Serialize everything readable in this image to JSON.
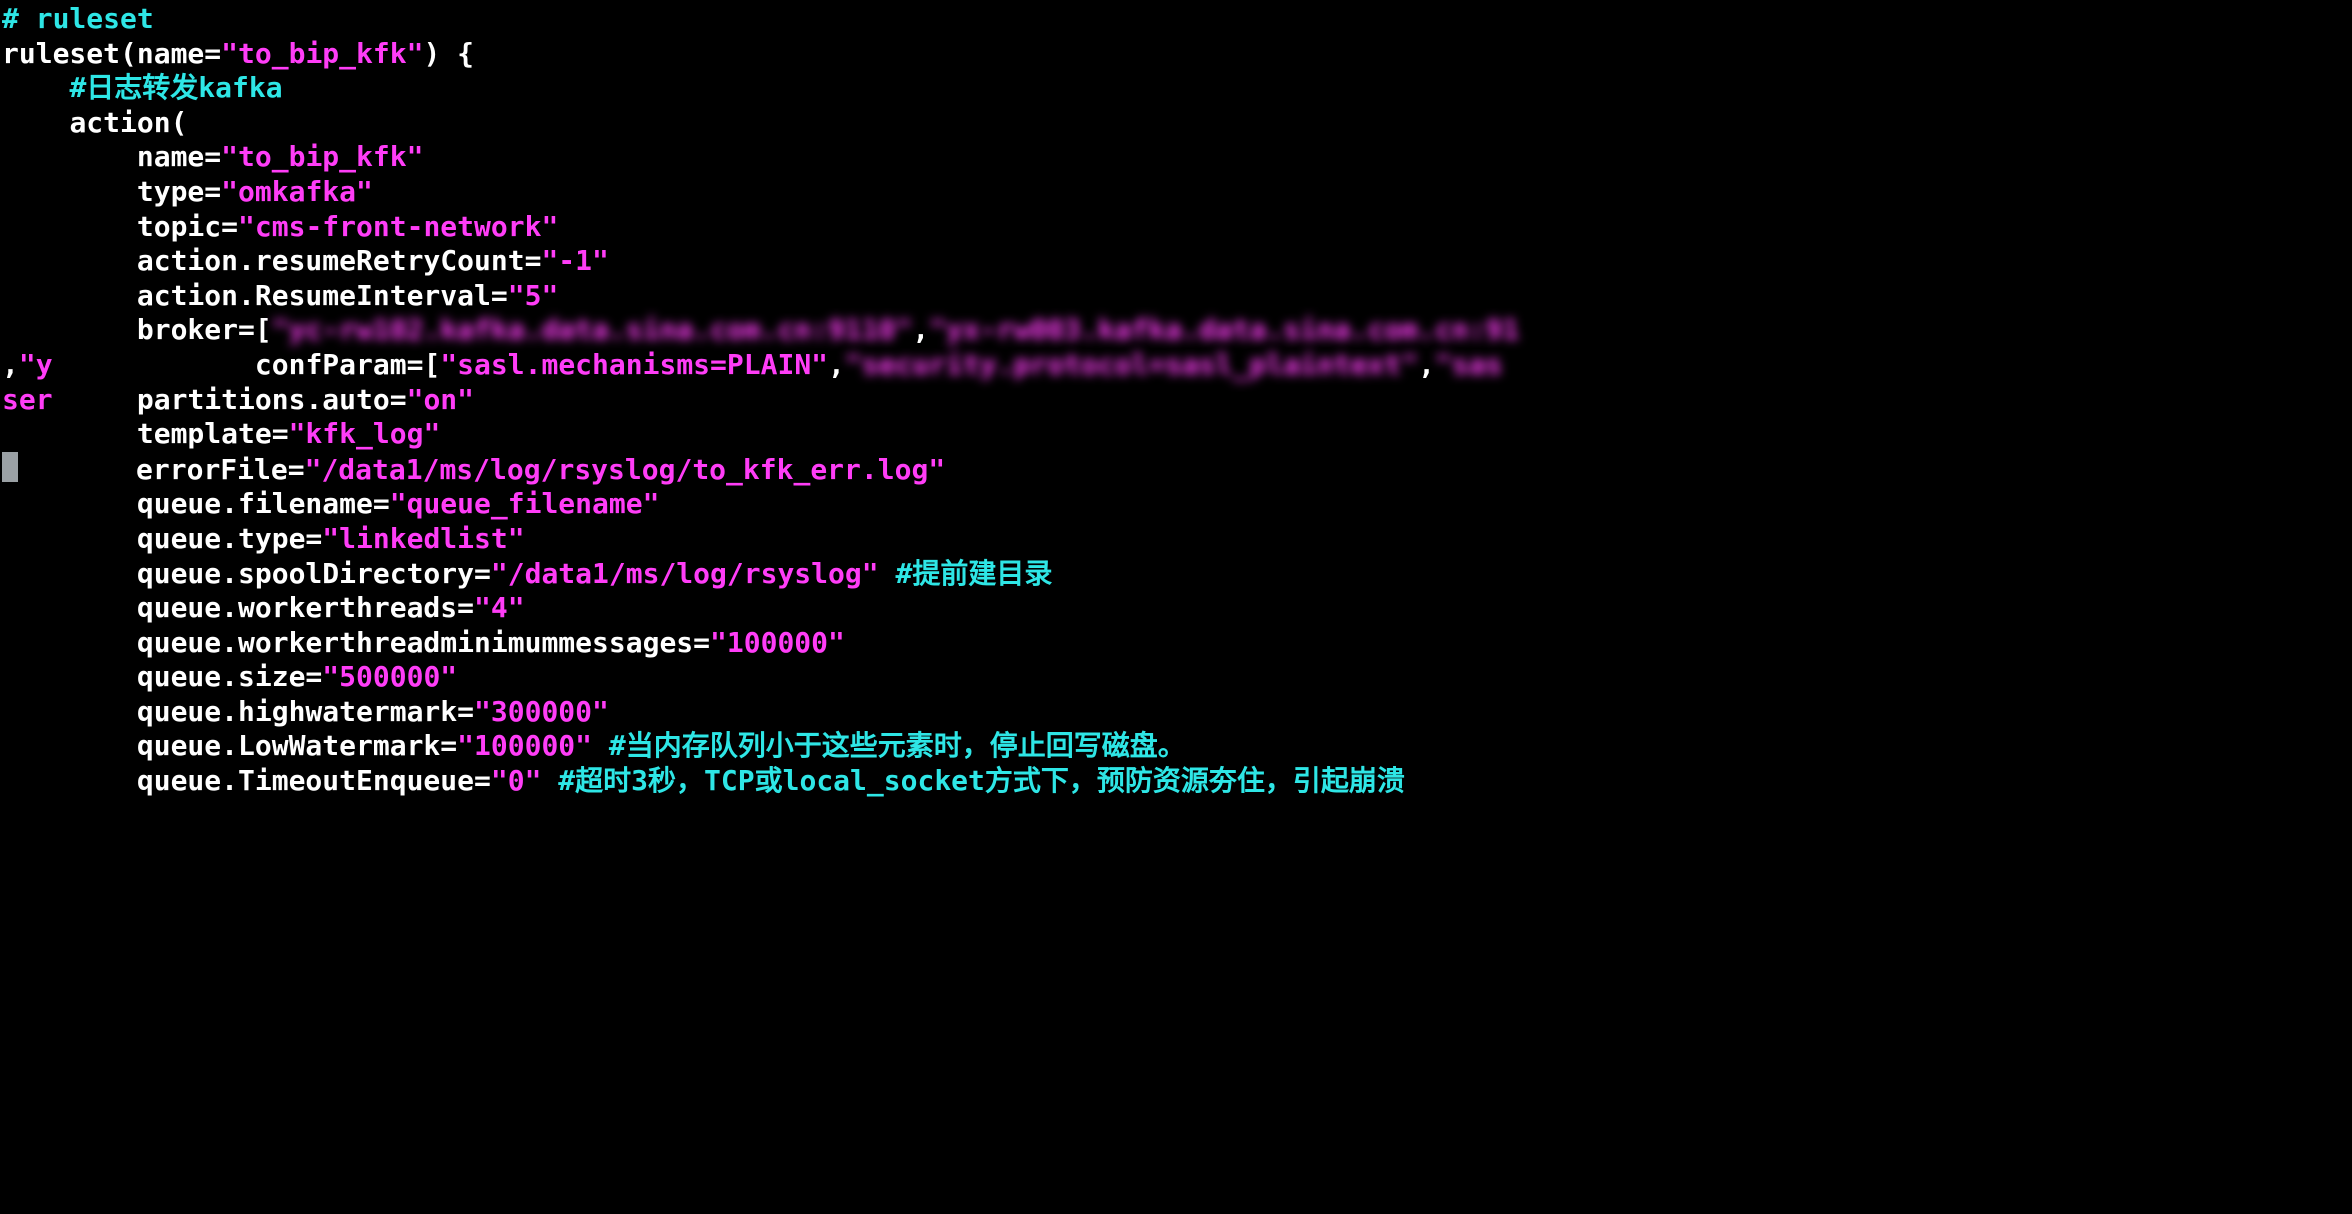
{
  "line1": {
    "comment": "# ruleset"
  },
  "line2": {
    "pre": "ruleset(name=",
    "str": "\"to_bip_kfk\"",
    "post": ") {"
  },
  "line3": {
    "comment": "#日志转发kafka"
  },
  "line4": {
    "text": "action("
  },
  "line5": {
    "key": "name=",
    "str": "\"to_bip_kfk\""
  },
  "line6": {
    "key": "type=",
    "str": "\"omkafka\""
  },
  "line7": {
    "key": "topic=",
    "str": "\"cms-front-network\""
  },
  "line8": {
    "key": "action.resumeRetryCount=",
    "str": "\"-1\""
  },
  "line9": {
    "key": "action.ResumeInterval=",
    "str": "\"5\""
  },
  "line10": {
    "key": "broker=[",
    "broker1": "\"yc-rw102.kafka.data.sina.com.cn:9110\"",
    "sep": ",",
    "broker2": "\"yx-rw003.kafka.data.sina.com.cn:91"
  },
  "line11a": {
    "pre": ",",
    "str": "\"y"
  },
  "line11b": {
    "key": "confParam=[",
    "p1": "\"sasl.mechanisms=PLAIN\"",
    "sep": ",",
    "p2": "\"security.protocol=sasl_plaintext\"",
    "sep2": ",",
    "p3": "\"sas"
  },
  "line12a": {
    "text": "ser"
  },
  "line12b": {
    "key": "partitions.auto=",
    "str": "\"on\""
  },
  "line13": {
    "key": "template=",
    "str": "\"kfk_log\""
  },
  "line14": {
    "key": "errorFile=",
    "str": "\"/data1/ms/log/rsyslog/to_kfk_err.log\""
  },
  "line15": {
    "key": "queue.filename=",
    "str": "\"queue_filename\""
  },
  "line16": {
    "key": "queue.type=",
    "str": "\"linkedlist\""
  },
  "line17": {
    "key": "queue.spoolDirectory=",
    "str": "\"/data1/ms/log/rsyslog\"",
    "comment": " #提前建目录"
  },
  "line18": {
    "key": "queue.workerthreads=",
    "str": "\"4\""
  },
  "line19": {
    "key": "queue.workerthreadminimummessages=",
    "str": "\"100000\""
  },
  "line20": {
    "key": "queue.size=",
    "str": "\"500000\""
  },
  "line21": {
    "key": "queue.highwatermark=",
    "str": "\"300000\""
  },
  "line22": {
    "key": "queue.LowWatermark=",
    "str": "\"100000\"",
    "comment": " #当内存队列小于这些元素时，停止回写磁盘。"
  },
  "line23": {
    "key": "queue.TimeoutEnqueue=",
    "str": "\"0\"",
    "comment": " #超时3秒，TCP或local_socket方式下，预防资源夯住，引起崩溃"
  }
}
